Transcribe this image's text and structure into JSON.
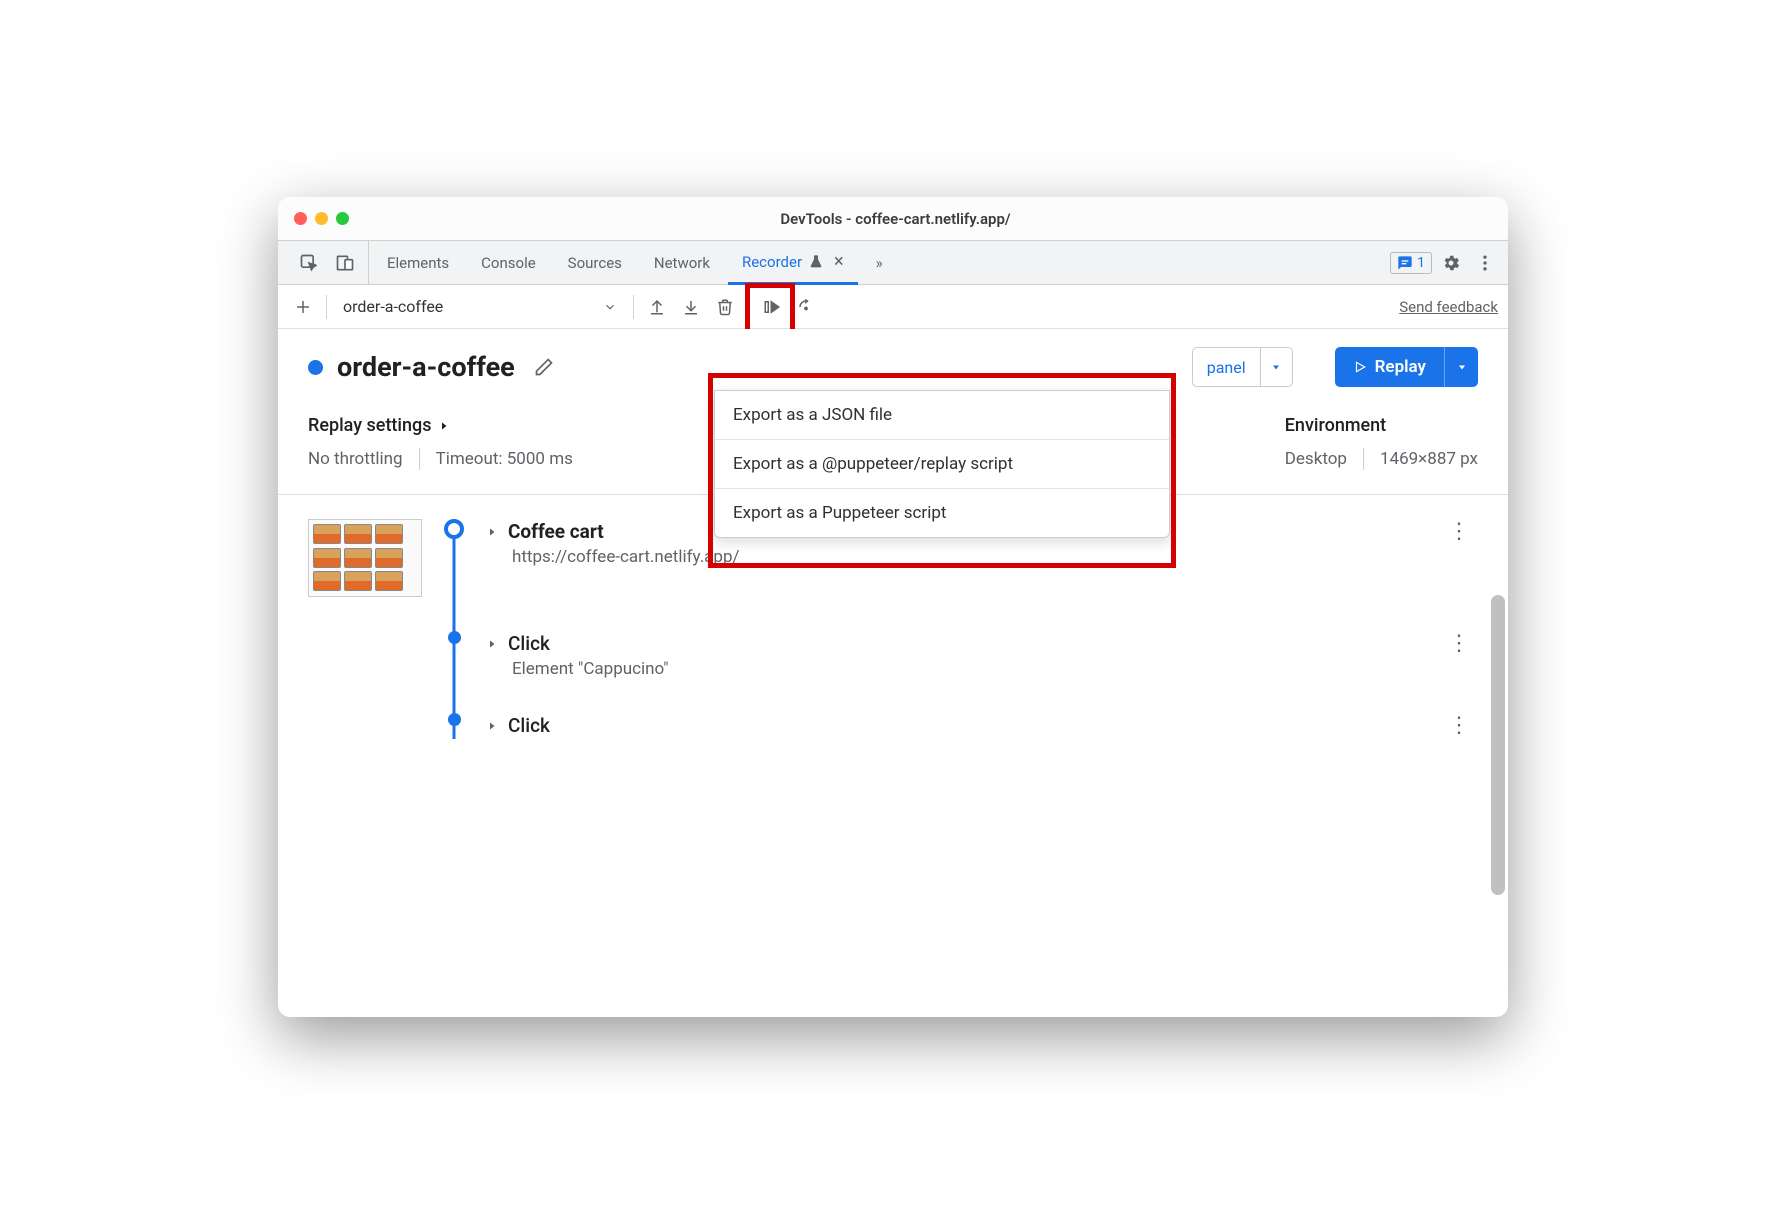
{
  "window": {
    "title": "DevTools - coffee-cart.netlify.app/"
  },
  "tabs": {
    "elements": "Elements",
    "console": "Console",
    "sources": "Sources",
    "network": "Network",
    "recorder": "Recorder",
    "overflow": "»"
  },
  "issues_badge": "1",
  "toolbar": {
    "recording_select": "order-a-coffee",
    "send_feedback": "Send feedback"
  },
  "export_menu": {
    "items": [
      "Export as a JSON file",
      "Export as a @puppeteer/replay script",
      "Export as a Puppeteer script"
    ]
  },
  "recording": {
    "name": "order-a-coffee",
    "perf_panel_label": "panel",
    "replay_label": "Replay"
  },
  "replay_settings": {
    "title": "Replay settings",
    "throttling": "No throttling",
    "timeout": "Timeout: 5000 ms"
  },
  "environment": {
    "title": "Environment",
    "device": "Desktop",
    "viewport": "1469×887 px"
  },
  "steps": [
    {
      "title": "Coffee cart",
      "sub": "https://coffee-cart.netlify.app/",
      "bold": true,
      "has_thumb": true,
      "node": "open"
    },
    {
      "title": "Click",
      "sub": "Element \"Cappucino\"",
      "bold": false,
      "has_thumb": false,
      "node": "filled"
    },
    {
      "title": "Click",
      "sub": "",
      "bold": false,
      "has_thumb": false,
      "node": "filled"
    }
  ]
}
